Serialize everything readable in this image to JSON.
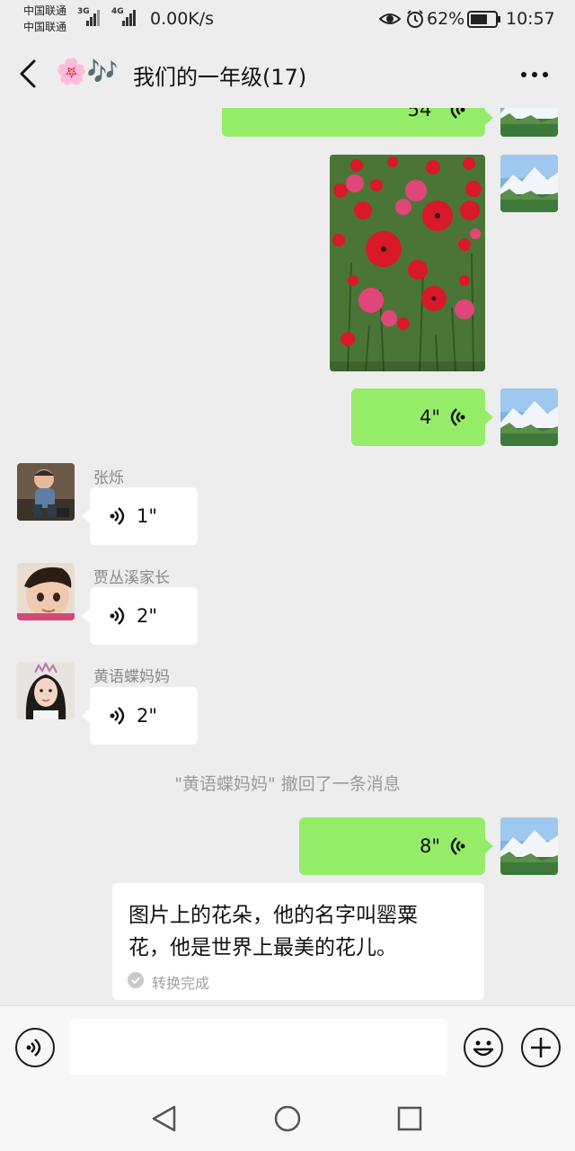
{
  "status_bar": {
    "carrier_1": "中国联通",
    "carrier_2": "中国联通",
    "net_1": "3G",
    "net_2": "4G",
    "speed": "0.00K/s",
    "battery": "62%",
    "time": "10:57"
  },
  "header": {
    "title_emoji": "🌸🎶",
    "title": "我们的一年级(17)",
    "back_icon": "chevron-left-icon",
    "more_icon": "more-dots-icon"
  },
  "messages": {
    "m1_duration": "54\"",
    "m3_duration": "4\"",
    "m4_sender": "张烁",
    "m4_duration": "1\"",
    "m5_sender": "贾丛溪家长",
    "m5_duration": "2\"",
    "m6_sender": "黄语蝶妈妈",
    "m6_duration": "2\"",
    "system_notice": "\"黄语蝶妈妈\" 撤回了一条消息",
    "m7_duration": "8\"",
    "transcript_line1": "图片上的花朵，他的名字叫罂粟",
    "transcript_line2": "花，他是世界上最美的花儿。",
    "transcript_status": "转换完成"
  },
  "input_bar": {
    "value": "",
    "placeholder": ""
  },
  "colors": {
    "bubble_me": "#95ec69",
    "bubble_other": "#ffffff",
    "background": "#ededed"
  }
}
